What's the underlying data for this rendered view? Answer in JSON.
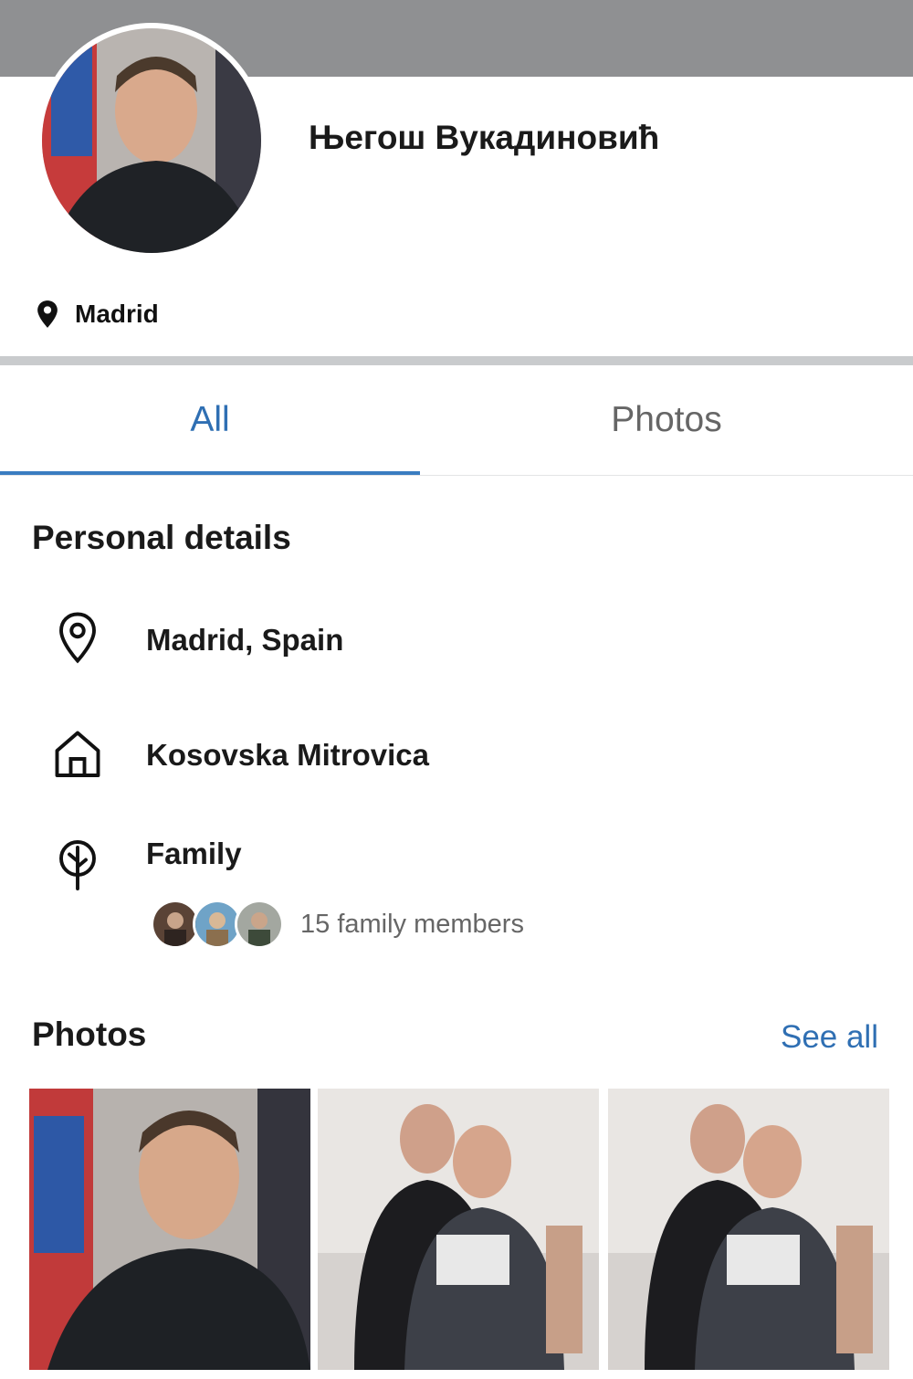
{
  "profile": {
    "name": "Његош Вукадиновић",
    "location_short": "Madrid"
  },
  "tabs": [
    {
      "label": "All",
      "active": true
    },
    {
      "label": "Photos",
      "active": false
    }
  ],
  "personal_details": {
    "title": "Personal details",
    "current_city": "Madrid, Spain",
    "hometown": "Kosovska Mitrovica",
    "family_label": "Family",
    "family_members": "15 family members"
  },
  "photos": {
    "title": "Photos",
    "see_all": "See all"
  },
  "colors": {
    "accent": "#2f6fb3",
    "cover": "#8f9092"
  },
  "icons": [
    "map-pin-icon",
    "location-pin-icon",
    "home-icon",
    "family-tree-icon"
  ]
}
